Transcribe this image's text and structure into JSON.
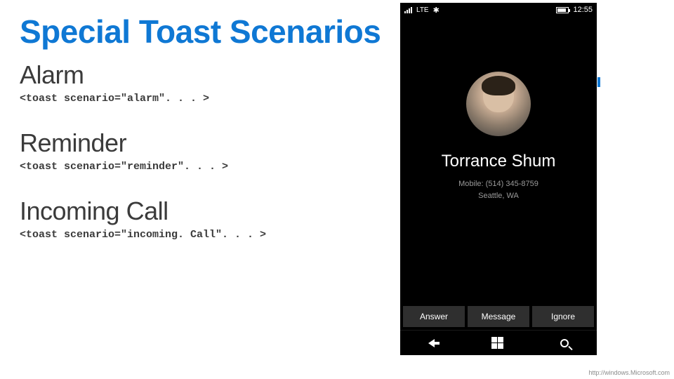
{
  "title": "Special Toast Scenarios",
  "sections": [
    {
      "heading": "Alarm",
      "code": "<toast scenario=\"alarm\". . . >"
    },
    {
      "heading": "Reminder",
      "code": "<toast scenario=\"reminder\". . . >"
    },
    {
      "heading": "Incoming Call",
      "code": "<toast scenario=\"incoming. Call\". . . >"
    }
  ],
  "phone": {
    "status": {
      "network": "LTE",
      "time": "12:55"
    },
    "caller": {
      "name": "Torrance Shum",
      "line1": "Mobile: (514) 345-8759",
      "line2": "Seattle, WA"
    },
    "buttons": {
      "answer": "Answer",
      "message": "Message",
      "ignore": "Ignore"
    }
  },
  "footer_url": "http://windows.Microsoft.com"
}
